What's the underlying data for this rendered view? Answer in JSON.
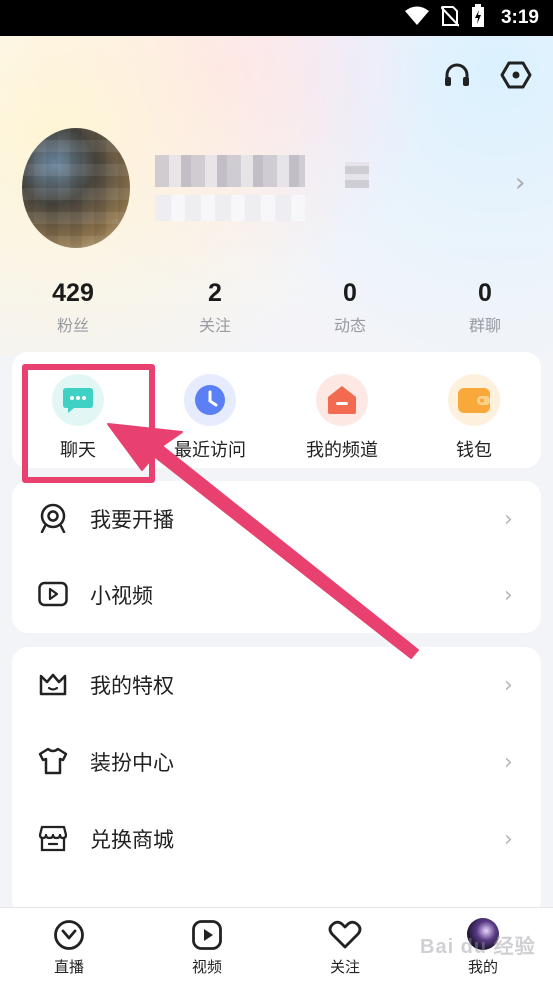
{
  "status_bar": {
    "time": "3:19",
    "icons": [
      "wifi-icon",
      "no-sim-icon",
      "battery-charging-icon"
    ]
  },
  "header": {
    "icons": [
      "headset-icon",
      "settings-hexagon-icon"
    ]
  },
  "profile": {
    "avatar": "blurred-user-avatar"
  },
  "stats": [
    {
      "value": "429",
      "label": "粉丝"
    },
    {
      "value": "2",
      "label": "关注"
    },
    {
      "value": "0",
      "label": "动态"
    },
    {
      "value": "0",
      "label": "群聊"
    }
  ],
  "quick_actions": [
    {
      "label": "聊天",
      "icon": "chat-bubble-icon",
      "color": "#3fd1c4",
      "bg": "#e2f7f5"
    },
    {
      "label": "最近访问",
      "icon": "clock-icon",
      "color": "#5b7ff5",
      "bg": "#e6ecfd"
    },
    {
      "label": "我的频道",
      "icon": "house-icon",
      "color": "#f26a4f",
      "bg": "#fde8e3"
    },
    {
      "label": "钱包",
      "icon": "wallet-icon",
      "color": "#f9a93a",
      "bg": "#fdf0dc"
    }
  ],
  "menu_group_1": [
    {
      "label": "我要开播",
      "icon": "broadcast-camera-icon"
    },
    {
      "label": "小视频",
      "icon": "video-play-icon"
    }
  ],
  "menu_group_2": [
    {
      "label": "我的特权",
      "icon": "crown-icon"
    },
    {
      "label": "装扮中心",
      "icon": "tshirt-icon"
    },
    {
      "label": "兑换商城",
      "icon": "store-icon"
    }
  ],
  "tabbar": [
    {
      "label": "直播",
      "icon": "live-check-icon"
    },
    {
      "label": "视频",
      "icon": "play-icon"
    },
    {
      "label": "关注",
      "icon": "heart-icon"
    },
    {
      "label": "我的",
      "icon": "user-avatar"
    }
  ],
  "watermark": "Bai du 经验",
  "annotation": {
    "color": "#e9416f"
  }
}
